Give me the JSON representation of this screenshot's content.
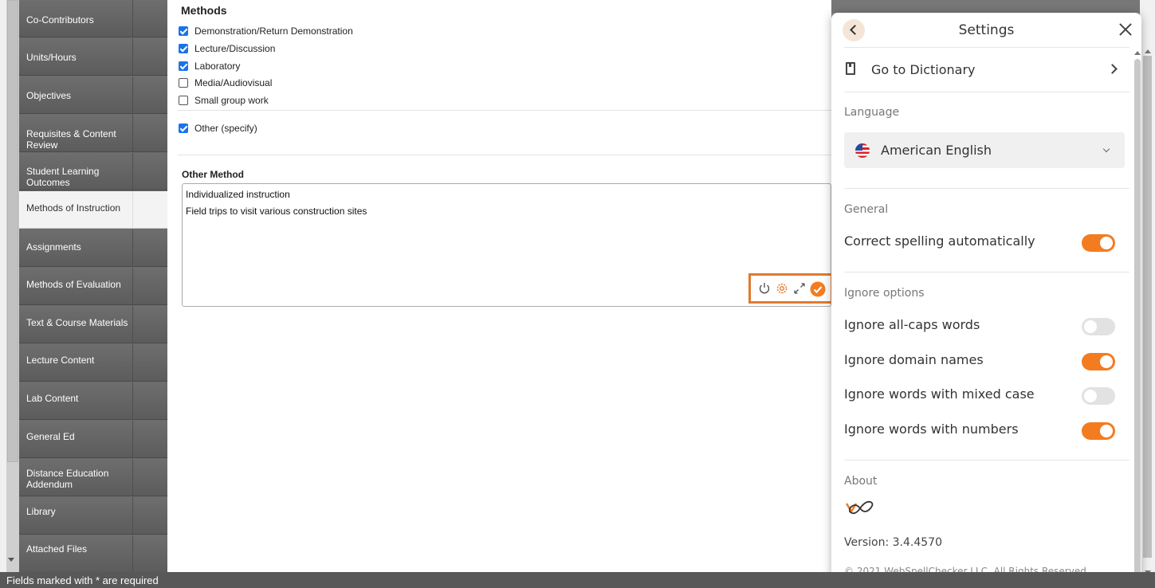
{
  "sidebar": {
    "items": [
      {
        "label": "Co-Contributors",
        "active": false
      },
      {
        "label": "Units/Hours",
        "active": false
      },
      {
        "label": "Objectives",
        "active": false
      },
      {
        "label": "Requisites & Content Review",
        "active": false
      },
      {
        "label": "Student Learning Outcomes",
        "active": false
      },
      {
        "label": "Methods of Instruction",
        "active": true
      },
      {
        "label": "Assignments",
        "active": false
      },
      {
        "label": "Methods of Evaluation",
        "active": false
      },
      {
        "label": "Text & Course Materials",
        "active": false
      },
      {
        "label": "Lecture Content",
        "active": false
      },
      {
        "label": "Lab Content",
        "active": false
      },
      {
        "label": "General Ed",
        "active": false
      },
      {
        "label": "Distance Education Addendum",
        "active": false
      },
      {
        "label": "Library",
        "active": false
      },
      {
        "label": "Attached Files",
        "active": false
      }
    ]
  },
  "status_bar": {
    "text": "Fields marked with * are required"
  },
  "main": {
    "title": "Methods",
    "methods": [
      {
        "label": "Demonstration/Return Demonstration",
        "checked": true
      },
      {
        "label": "Lecture/Discussion",
        "checked": true
      },
      {
        "label": "Laboratory",
        "checked": true
      },
      {
        "label": "Media/Audiovisual",
        "checked": false
      },
      {
        "label": "Small group work",
        "checked": false
      }
    ],
    "other": {
      "label": "Other (specify)",
      "checked": true
    },
    "other_method": {
      "label": "Other Method",
      "lines": [
        "Individualized instruction",
        "Field trips to visit various construction sites"
      ]
    },
    "spellcheck_badge": {
      "icons": [
        "power-icon",
        "settings-gear-icon",
        "expand-icon",
        "checkmark-icon"
      ],
      "accent": "#e07a2f"
    }
  },
  "settings": {
    "title": "Settings",
    "dictionary_link": "Go to Dictionary",
    "language_heading": "Language",
    "language_value": "American English",
    "general_heading": "General",
    "general_options": [
      {
        "label": "Correct spelling automatically",
        "on": true
      }
    ],
    "ignore_heading": "Ignore options",
    "ignore_options": [
      {
        "label": "Ignore all-caps words",
        "on": false
      },
      {
        "label": "Ignore domain names",
        "on": true
      },
      {
        "label": "Ignore words with mixed case",
        "on": false
      },
      {
        "label": "Ignore words with numbers",
        "on": true
      }
    ],
    "about_heading": "About",
    "version": "Version: 3.4.4570",
    "copyright": "© 2021 WebSpellChecker LLC. All Rights Reserved.",
    "toggle_on_color": "#f47c20",
    "toggle_off_color": "#e2e2e2"
  }
}
